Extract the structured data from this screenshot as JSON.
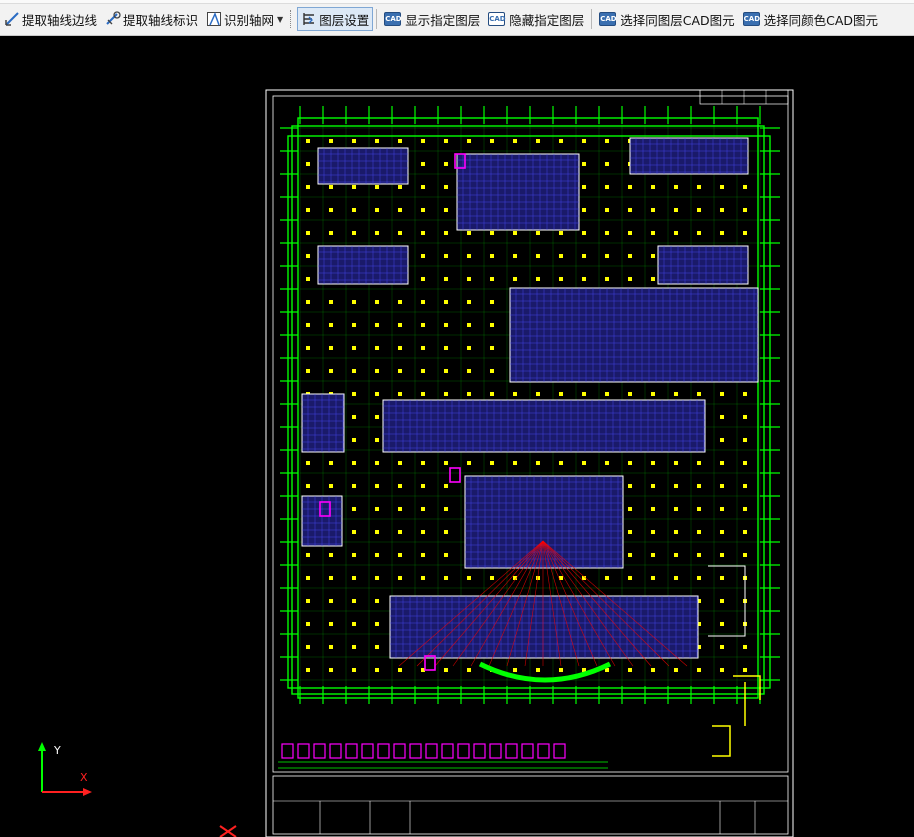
{
  "toolbar": {
    "extract_axis_edge": "提取轴线边线",
    "extract_axis_label": "提取轴线标识",
    "identify_axis_grid": "识别轴网",
    "layer_settings": "图层设置",
    "show_layer": "显示指定图层",
    "hide_layer": "隐藏指定图层",
    "select_same_layer": "选择同图层CAD图元",
    "select_same_color": "选择同颜色CAD图元",
    "cad_badge": "CAD"
  },
  "axes": {
    "y_label": "Y",
    "x_label": "X"
  },
  "colors": {
    "background": "#000000",
    "axis_lines": "#00ff00",
    "columns": "#ffff00",
    "grid": "#4a4aff",
    "highlight": "#ff00ff",
    "red": "#ff0000",
    "frame": "#ffffff"
  }
}
